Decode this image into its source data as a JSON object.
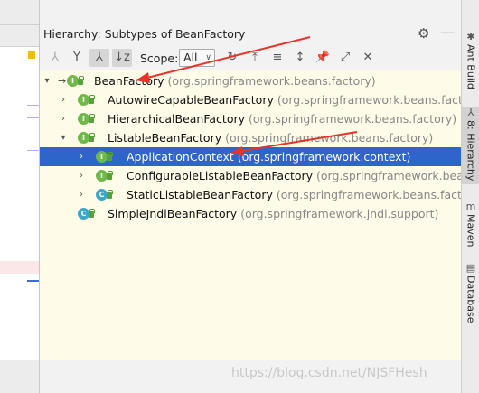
{
  "panel": {
    "title": "Hierarchy:",
    "subtitle": "Subtypes of BeanFactory"
  },
  "toolbar": {
    "scope_label": "Scope:",
    "scope_value": "All"
  },
  "tree": [
    {
      "name": "BeanFactory",
      "pkg": "(org.springframework.beans.factory)"
    },
    {
      "name": "AutowireCapableBeanFactory",
      "pkg": "(org.springframework.beans.factory.c"
    },
    {
      "name": "HierarchicalBeanFactory",
      "pkg": "(org.springframework.beans.factory)"
    },
    {
      "name": "ListableBeanFactory",
      "pkg": "(org.springframework.beans.factory)"
    },
    {
      "name": "ApplicationContext",
      "pkg": "(org.springframework.context)"
    },
    {
      "name": "ConfigurableListableBeanFactory",
      "pkg": "(org.springframework.beans.facto"
    },
    {
      "name": "StaticListableBeanFactory",
      "pkg": "(org.springframework.beans.factory.su"
    },
    {
      "name": "SimpleJndiBeanFactory",
      "pkg": "(org.springframework.jndi.support)"
    }
  ],
  "right_tabs": {
    "ant": "Ant Build",
    "hierarchy": "8: Hierarchy",
    "maven": "Maven",
    "database": "Database"
  },
  "watermark": "https://blog.csdn.net/NJSFHesh",
  "colors": {
    "selection": "#2f65ca",
    "tree_background": "#fefbe8",
    "interface_icon": "#6fb94b",
    "class_icon": "#3ca8c9",
    "annotation_arrow": "#e8332a"
  }
}
